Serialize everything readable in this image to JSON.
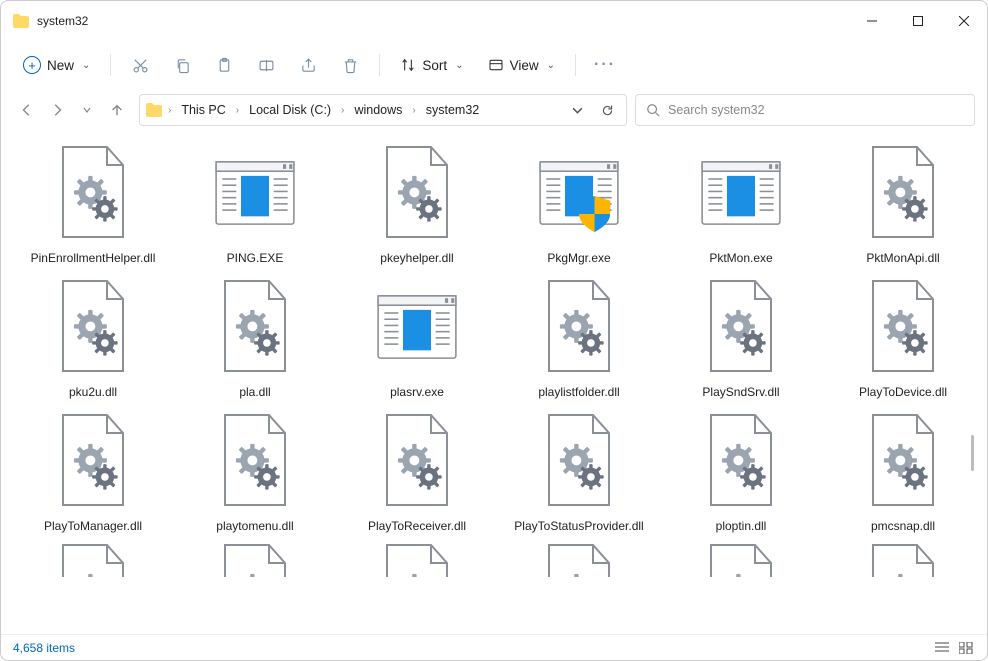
{
  "window": {
    "title": "system32"
  },
  "toolbar": {
    "new_label": "New",
    "sort_label": "Sort",
    "view_label": "View"
  },
  "breadcrumbs": [
    "This PC",
    "Local Disk (C:)",
    "windows",
    "system32"
  ],
  "search": {
    "placeholder": "Search system32"
  },
  "status": {
    "count_label": "4,658 items"
  },
  "files": [
    {
      "name": "PinEnrollmentHelper.dll",
      "icon": "dll"
    },
    {
      "name": "PING.EXE",
      "icon": "exe"
    },
    {
      "name": "pkeyhelper.dll",
      "icon": "dll"
    },
    {
      "name": "PkgMgr.exe",
      "icon": "exe-shield"
    },
    {
      "name": "PktMon.exe",
      "icon": "exe"
    },
    {
      "name": "PktMonApi.dll",
      "icon": "dll"
    },
    {
      "name": "pku2u.dll",
      "icon": "dll"
    },
    {
      "name": "pla.dll",
      "icon": "dll"
    },
    {
      "name": "plasrv.exe",
      "icon": "exe"
    },
    {
      "name": "playlistfolder.dll",
      "icon": "dll"
    },
    {
      "name": "PlaySndSrv.dll",
      "icon": "dll"
    },
    {
      "name": "PlayToDevice.dll",
      "icon": "dll"
    },
    {
      "name": "PlayToManager.dll",
      "icon": "dll"
    },
    {
      "name": "playtomenu.dll",
      "icon": "dll"
    },
    {
      "name": "PlayToReceiver.dll",
      "icon": "dll"
    },
    {
      "name": "PlayToStatusProvider.dll",
      "icon": "dll"
    },
    {
      "name": "ploptin.dll",
      "icon": "dll"
    },
    {
      "name": "pmcsnap.dll",
      "icon": "dll"
    }
  ]
}
